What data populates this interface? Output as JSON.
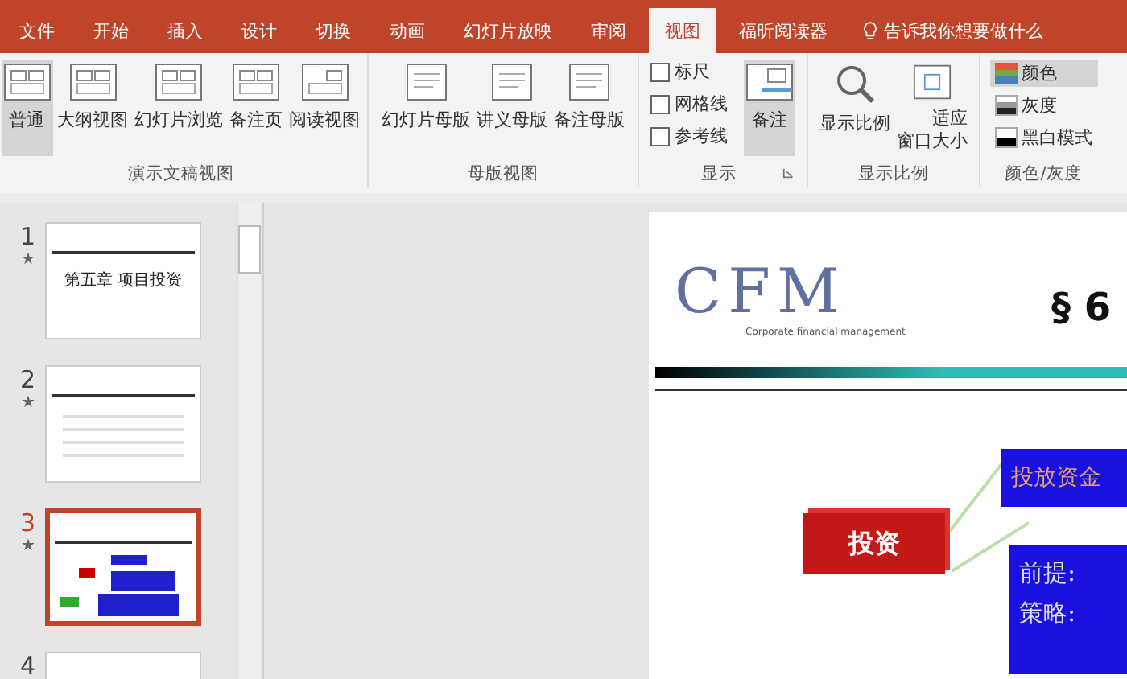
{
  "tabs": [
    {
      "label": "文件",
      "selected": false
    },
    {
      "label": "开始",
      "selected": false
    },
    {
      "label": "插入",
      "selected": false
    },
    {
      "label": "设计",
      "selected": false
    },
    {
      "label": "切换",
      "selected": false
    },
    {
      "label": "动画",
      "selected": false
    },
    {
      "label": "幻灯片放映",
      "selected": false
    },
    {
      "label": "审阅",
      "selected": false
    },
    {
      "label": "视图",
      "selected": true
    },
    {
      "label": "福昕阅读器",
      "selected": false
    }
  ],
  "tell_me": "告诉我你想要做什么",
  "ribbon": {
    "presentation_views": {
      "label": "演示文稿视图",
      "buttons": [
        {
          "label": "普通",
          "selected": true
        },
        {
          "label": "大纲视图",
          "selected": false
        },
        {
          "label": "幻灯片浏览",
          "selected": false
        },
        {
          "label": "备注页",
          "selected": false
        },
        {
          "label": "阅读视图",
          "selected": false
        }
      ]
    },
    "master_views": {
      "label": "母版视图",
      "buttons": [
        {
          "label": "幻灯片母版"
        },
        {
          "label": "讲义母版"
        },
        {
          "label": "备注母版"
        }
      ]
    },
    "show": {
      "label": "显示",
      "checkboxes": [
        {
          "label": "标尺",
          "checked": false
        },
        {
          "label": "网格线",
          "checked": false
        },
        {
          "label": "参考线",
          "checked": false
        }
      ],
      "notes": {
        "label": "备注",
        "selected": true
      }
    },
    "zoom": {
      "label": "显示比例",
      "buttons": [
        {
          "label": "显示比例"
        },
        {
          "lines": [
            "适应",
            "窗口大小"
          ]
        }
      ]
    },
    "color": {
      "label": "颜色/灰度",
      "options": [
        {
          "label": "颜色",
          "selected": true
        },
        {
          "label": "灰度",
          "selected": false
        },
        {
          "label": "黑白模式",
          "selected": false
        }
      ]
    }
  },
  "slides": [
    {
      "number": "1",
      "star": "★",
      "selected": false,
      "title": "第五章 项目投资"
    },
    {
      "number": "2",
      "star": "★",
      "selected": false
    },
    {
      "number": "3",
      "star": "★",
      "selected": true
    },
    {
      "number": "4",
      "selected": false
    }
  ],
  "slide": {
    "logo": "CFM",
    "logo_tagline": "Corporate financial management",
    "title": "§ 6",
    "node": "投资",
    "box_1": "投放资金",
    "box_2": [
      "前提:",
      "策略:"
    ]
  }
}
